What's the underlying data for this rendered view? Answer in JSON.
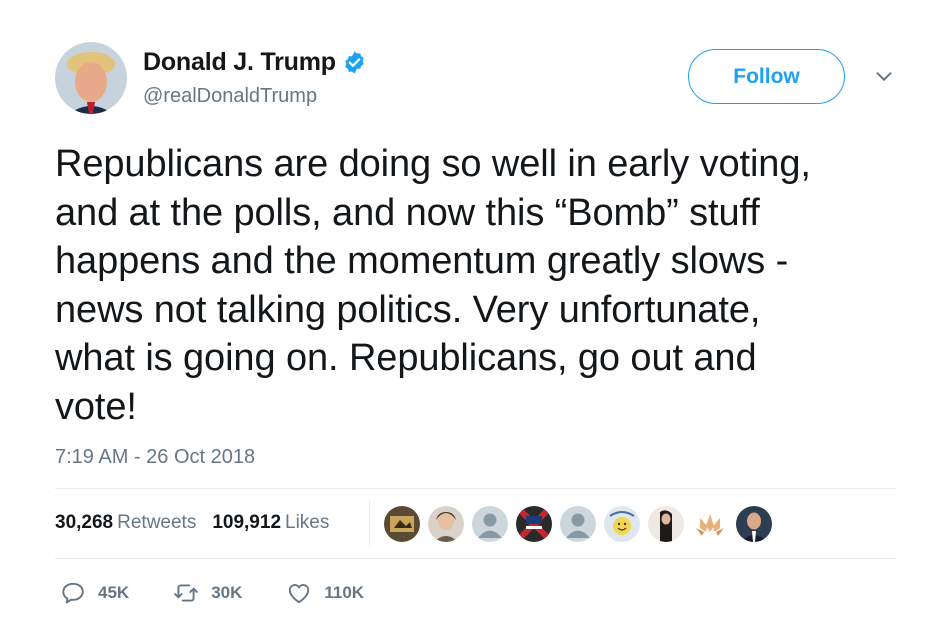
{
  "user": {
    "display_name": "Donald J. Trump",
    "handle": "@realDonaldTrump",
    "verified_icon": "verified-badge-icon"
  },
  "header": {
    "follow_label": "Follow",
    "caret_icon": "chevron-down-icon"
  },
  "tweet": {
    "text": "Republicans are doing so well in early voting,\nand at the polls, and now this “Bomb” stuff\nhappens and the momentum greatly slows -\nnews not talking politics. Very unfortunate,\nwhat is going on. Republicans, go out and\nvote!",
    "timestamp": "7:19 AM - 26 Oct 2018"
  },
  "stats": {
    "retweets_count": "30,268",
    "retweets_label": "Retweets",
    "likes_count": "109,912",
    "likes_label": "Likes"
  },
  "likers": [
    {
      "icon": "liker-avatar-1"
    },
    {
      "icon": "liker-avatar-2"
    },
    {
      "icon": "liker-avatar-default"
    },
    {
      "icon": "liker-avatar-4"
    },
    {
      "icon": "liker-avatar-default"
    },
    {
      "icon": "liker-avatar-6"
    },
    {
      "icon": "liker-avatar-7"
    },
    {
      "icon": "liker-avatar-8"
    },
    {
      "icon": "liker-avatar-9"
    }
  ],
  "actions": {
    "reply_count": "45K",
    "retweet_count": "30K",
    "like_count": "110K"
  },
  "colors": {
    "brand": "#1da1f2",
    "text": "#14171a",
    "secondary": "#657786",
    "divider": "#e6ecf0"
  }
}
